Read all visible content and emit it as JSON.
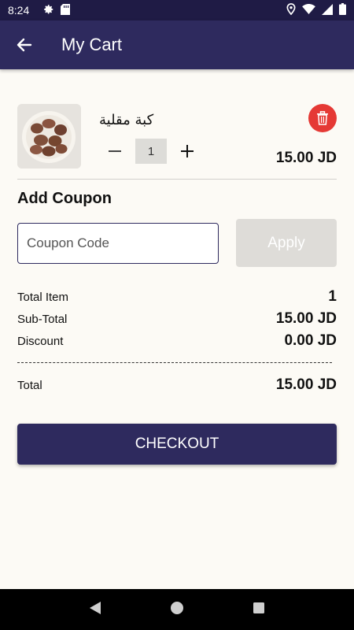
{
  "status_bar": {
    "time": "8:24",
    "left_icons": [
      "gear-icon",
      "sd-card-icon"
    ],
    "right_icons": [
      "location-icon",
      "wifi-icon",
      "signal-icon",
      "battery-icon"
    ]
  },
  "app_bar": {
    "back_icon": "arrow-left-icon",
    "title": "My Cart"
  },
  "cart_items": [
    {
      "name": "كبة مقلية",
      "quantity": "1",
      "price": "15.00 JD",
      "image": "fried-kibbeh-bowl"
    }
  ],
  "coupon": {
    "title": "Add Coupon",
    "placeholder": "Coupon Code",
    "value": "",
    "apply_label": "Apply"
  },
  "summary": {
    "total_item_label": "Total Item",
    "total_item_value": "1",
    "subtotal_label": "Sub-Total",
    "subtotal_value": "15.00 JD",
    "discount_label": "Discount",
    "discount_value": "0.00 JD",
    "total_label": "Total",
    "total_value": "15.00 JD"
  },
  "checkout_label": "CHECKOUT",
  "colors": {
    "primary": "#2e2a5e",
    "status_bar": "#1f1b45",
    "background": "#fcfaf5",
    "delete": "#e53935",
    "apply_disabled": "#dedcd8"
  }
}
